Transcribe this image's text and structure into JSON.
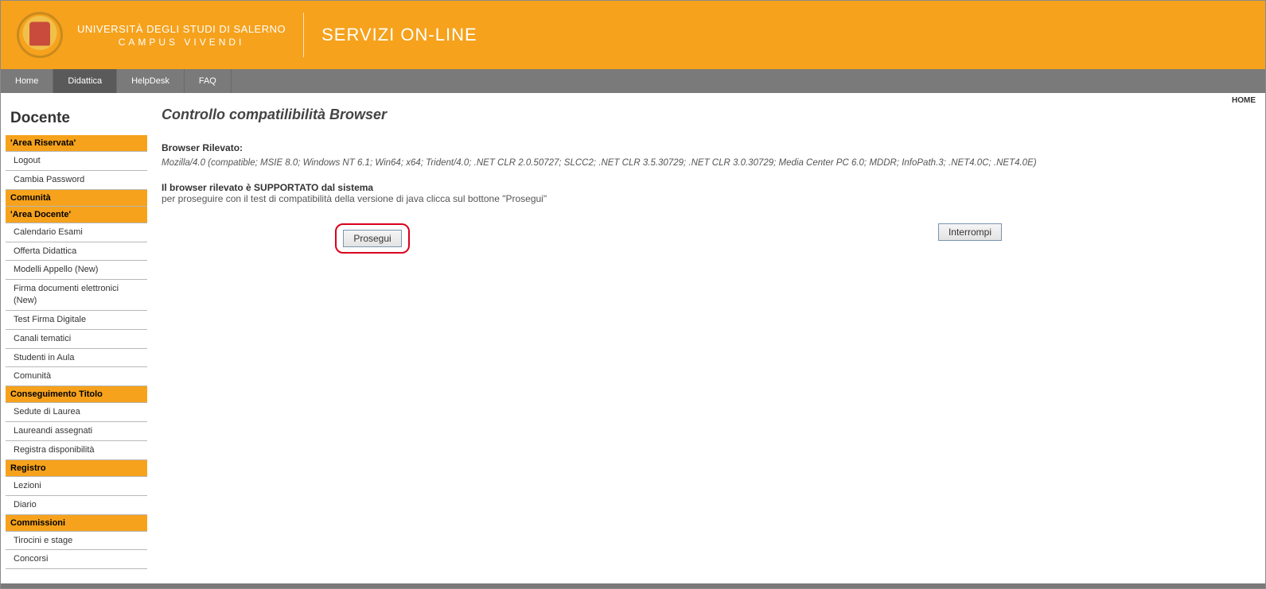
{
  "header": {
    "university_name": "UNIVERSITÀ DEGLI STUDI DI SALERNO",
    "motto": "CAMPUS VIVENDI",
    "service": "SERVIZI ON-LINE"
  },
  "nav": {
    "items": [
      "Home",
      "Didattica",
      "HelpDesk",
      "FAQ"
    ],
    "active_index": 1
  },
  "breadcrumb": "HOME",
  "sidebar": {
    "title": "Docente",
    "groups": [
      {
        "type": "header",
        "label": "'Area Riservata'"
      },
      {
        "type": "item",
        "label": "Logout"
      },
      {
        "type": "item",
        "label": "Cambia Password"
      },
      {
        "type": "header",
        "label": "Comunità"
      },
      {
        "type": "header",
        "label": "'Area Docente'"
      },
      {
        "type": "item",
        "label": "Calendario Esami"
      },
      {
        "type": "item",
        "label": "Offerta Didattica"
      },
      {
        "type": "item",
        "label": "Modelli Appello (New)"
      },
      {
        "type": "item",
        "label": "Firma documenti elettronici (New)"
      },
      {
        "type": "item",
        "label": "Test Firma Digitale"
      },
      {
        "type": "item",
        "label": "Canali tematici"
      },
      {
        "type": "item",
        "label": "Studenti in Aula"
      },
      {
        "type": "item",
        "label": "Comunità"
      },
      {
        "type": "header",
        "label": "Conseguimento Titolo"
      },
      {
        "type": "item",
        "label": "Sedute di Laurea"
      },
      {
        "type": "item",
        "label": "Laureandi assegnati"
      },
      {
        "type": "item",
        "label": "Registra disponibilità"
      },
      {
        "type": "header",
        "label": "Registro"
      },
      {
        "type": "item",
        "label": "Lezioni"
      },
      {
        "type": "item",
        "label": "Diario"
      },
      {
        "type": "header",
        "label": "Commissioni"
      },
      {
        "type": "item",
        "label": "Tirocini e stage"
      },
      {
        "type": "item",
        "label": "Concorsi"
      }
    ]
  },
  "main": {
    "title": "Controllo compatilibilità Browser",
    "detected_label": "Browser Rilevato:",
    "detected_value": "Mozilla/4.0 (compatible; MSIE 8.0; Windows NT 6.1; Win64; x64; Trident/4.0; .NET CLR 2.0.50727; SLCC2; .NET CLR 3.5.30729; .NET CLR 3.0.30729; Media Center PC 6.0; MDDR; InfoPath.3; .NET4.0C; .NET4.0E)",
    "support_line": "Il browser rilevato è SUPPORTATO dal sistema",
    "instruction_line": "per proseguire con il test di compatibilità della versione di java clicca sul bottone \"Prosegui\"",
    "proceed_button": "Prosegui",
    "cancel_button": "Interrompi"
  }
}
